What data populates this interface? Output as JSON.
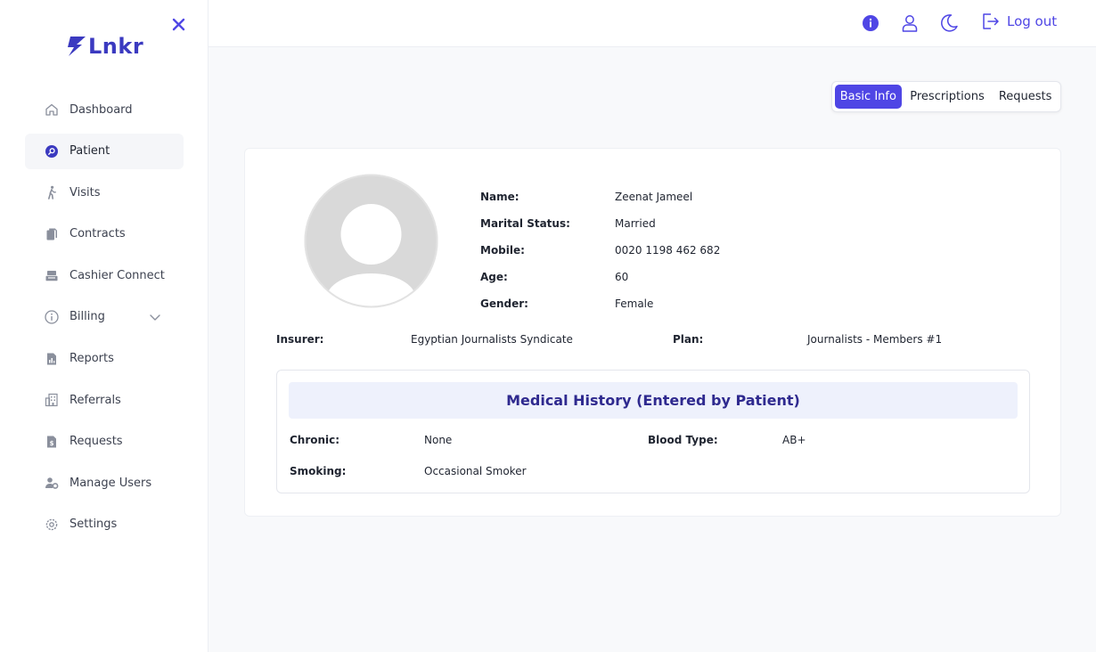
{
  "app": {
    "logo_text": "Lnkr"
  },
  "sidebar": {
    "items": [
      {
        "label": "Dashboard",
        "icon": "home-icon"
      },
      {
        "label": "Patient",
        "icon": "patient-search-icon",
        "active": true
      },
      {
        "label": "Visits",
        "icon": "walking-person-icon"
      },
      {
        "label": "Contracts",
        "icon": "documents-icon"
      },
      {
        "label": "Cashier Connect",
        "icon": "cash-register-icon"
      },
      {
        "label": "Billing",
        "icon": "info-circle-icon",
        "expandable": true
      },
      {
        "label": "Reports",
        "icon": "report-icon"
      },
      {
        "label": "Referrals",
        "icon": "referral-building-icon"
      },
      {
        "label": "Requests",
        "icon": "dollar-document-icon"
      },
      {
        "label": "Manage Users",
        "icon": "user-gear-icon"
      },
      {
        "label": "Settings",
        "icon": "gear-icon"
      }
    ]
  },
  "header": {
    "logout_label": "Log out"
  },
  "tabs": [
    {
      "label": "Basic Info",
      "active": true
    },
    {
      "label": "Prescriptions"
    },
    {
      "label": "Requests"
    }
  ],
  "patient": {
    "fields": [
      {
        "key": "Name:",
        "value": "Zeenat Jameel"
      },
      {
        "key": "Marital Status:",
        "value": "Married"
      },
      {
        "key": "Mobile:",
        "value": "0020 1198 462 682"
      },
      {
        "key": "Age:",
        "value": "60"
      },
      {
        "key": "Gender:",
        "value": "Female"
      }
    ],
    "insurer_label": "Insurer:",
    "insurer_value": "Egyptian Journalists Syndicate",
    "plan_label": "Plan:",
    "plan_value": "Journalists - Members #1"
  },
  "medical_history": {
    "title": "Medical History (Entered by Patient)",
    "chronic_label": "Chronic:",
    "chronic_value": "None",
    "blood_type_label": "Blood Type:",
    "blood_type_value": "AB+",
    "smoking_label": "Smoking:",
    "smoking_value": "Occasional Smoker"
  },
  "colors": {
    "accent": "#4f46e5",
    "brand": "#3b3ac0",
    "title_text": "#2f2a8f",
    "title_bg": "#eef1fc"
  }
}
